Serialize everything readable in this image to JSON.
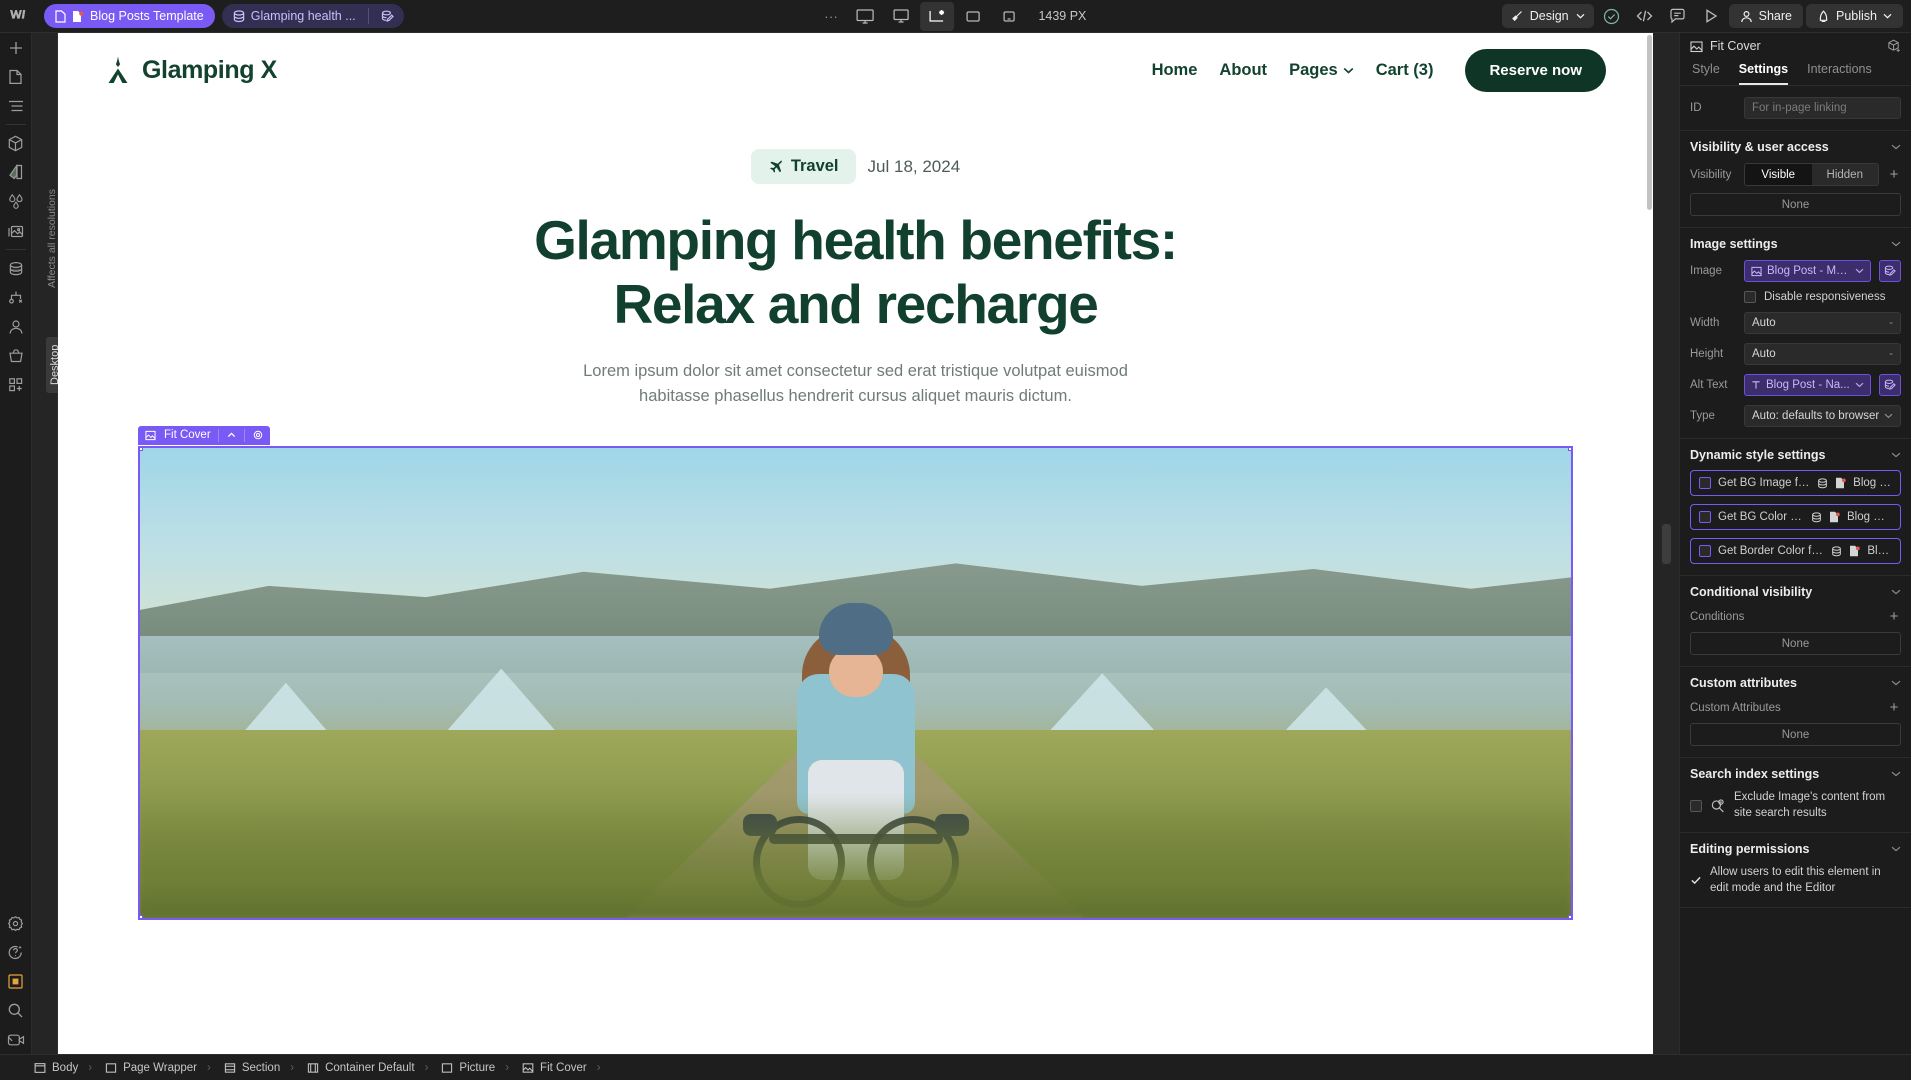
{
  "topbar": {
    "logo": "webflow-logo",
    "tabs": [
      {
        "label": "Blog Posts Template",
        "icons": [
          "page-icon",
          "cms-page-icon"
        ]
      },
      {
        "label": "Glamping health ...",
        "icons": [
          "collection-icon"
        ],
        "trailing_icon": "collection-edit-icon"
      }
    ],
    "overflow": "...",
    "breakpoints": [
      {
        "name": "desktop-breakpoint",
        "selected": false
      },
      {
        "name": "tablet-breakpoint",
        "selected": false
      },
      {
        "name": "base-breakpoint",
        "selected": true
      },
      {
        "name": "mobile-landscape-breakpoint",
        "selected": false
      },
      {
        "name": "mobile-portrait-breakpoint",
        "selected": false
      }
    ],
    "px_label": "1439 PX",
    "mode": "Design",
    "right_icons": [
      "audit-check-icon",
      "code-icon",
      "comment-icon",
      "preview-play-icon"
    ],
    "share": "Share",
    "publish": "Publish"
  },
  "rail": {
    "items": [
      {
        "name": "add-elements-icon"
      },
      {
        "name": "pages-icon"
      },
      {
        "name": "navigator-icon"
      },
      {
        "name": "components-icon"
      },
      {
        "name": "style-selector-icon"
      },
      {
        "name": "variables-icon"
      },
      {
        "name": "assets-icon"
      },
      {
        "name": "cms-icon"
      },
      {
        "name": "logic-icon"
      },
      {
        "name": "users-icon"
      },
      {
        "name": "ecommerce-icon"
      },
      {
        "name": "apps-icon"
      }
    ],
    "bottom_items": [
      {
        "name": "settings-gear-icon"
      },
      {
        "name": "ai-assist-icon"
      },
      {
        "name": "quick-find-box-icon",
        "active": true
      },
      {
        "name": "search-icon"
      },
      {
        "name": "video-tutorials-icon"
      }
    ]
  },
  "canvas": {
    "side_label_affects": "Affects all resolutions",
    "side_label_device": "Desktop",
    "selection_label": "Fit Cover",
    "site": {
      "brand": "Glamping X",
      "nav": [
        {
          "label": "Home"
        },
        {
          "label": "About"
        },
        {
          "label": "Pages",
          "has_chevron": true
        },
        {
          "label": "Cart (3)"
        }
      ],
      "cta": "Reserve now",
      "category": "Travel",
      "date": "Jul 18, 2024",
      "title_line1": "Glamping health benefits:",
      "title_line2": "Relax and recharge",
      "subtitle": "Lorem ipsum dolor sit amet consectetur sed erat tristique volutpat euismod habitasse phasellus hendrerit cursus aliquet mauris dictum."
    }
  },
  "panel": {
    "element_name": "Fit Cover",
    "tabs": [
      {
        "label": "Style",
        "active": false
      },
      {
        "label": "Settings",
        "active": true
      },
      {
        "label": "Interactions",
        "active": false
      }
    ],
    "id": {
      "label": "ID",
      "placeholder": "For in-page linking",
      "value": ""
    },
    "visibility": {
      "title": "Visibility & user access",
      "row_label": "Visibility",
      "options": [
        "Visible",
        "Hidden"
      ],
      "selected": "Visible",
      "none": "None"
    },
    "image_settings": {
      "title": "Image settings",
      "image_label": "Image",
      "image_value": "Blog Post - Ma...",
      "disable_responsiveness": "Disable responsiveness",
      "width_label": "Width",
      "width_value": "Auto",
      "height_label": "Height",
      "height_value": "Auto",
      "alt_label": "Alt Text",
      "alt_value": "Blog Post - Na...",
      "type_label": "Type",
      "type_value": "Auto: defaults to browser"
    },
    "dynamic_style": {
      "title": "Dynamic style settings",
      "rows": [
        {
          "label": "Get BG Image from",
          "source": "Blog P...",
          "checked": false
        },
        {
          "label": "Get BG Color from",
          "source": "Blog Po...",
          "checked": false
        },
        {
          "label": "Get Border Color from",
          "source": "Blo...",
          "checked": false
        }
      ]
    },
    "conditional": {
      "title": "Conditional visibility",
      "sub_label": "Conditions",
      "none": "None"
    },
    "custom_attributes": {
      "title": "Custom attributes",
      "sub_label": "Custom Attributes",
      "none": "None"
    },
    "search_index": {
      "title": "Search index settings",
      "checkbox_label": "Exclude Image's content from site search results",
      "checked": false
    },
    "editing_permissions": {
      "title": "Editing permissions",
      "checkbox_label": "Allow users to edit this element in edit mode and the Editor",
      "checked": true
    }
  },
  "breadcrumb": [
    {
      "label": "Body",
      "icon": "body-icon"
    },
    {
      "label": "Page Wrapper",
      "icon": "div-icon"
    },
    {
      "label": "Section",
      "icon": "section-icon"
    },
    {
      "label": "Container Default",
      "icon": "container-icon"
    },
    {
      "label": "Picture",
      "icon": "div-icon"
    },
    {
      "label": "Fit Cover",
      "icon": "image-icon"
    }
  ],
  "colors": {
    "purple": "#7a5af5",
    "brand_green": "#0f3526",
    "badge_bg": "#e3f2ea",
    "panel_bg": "#1c1c1c",
    "accent_orange": "#e8a33d"
  }
}
